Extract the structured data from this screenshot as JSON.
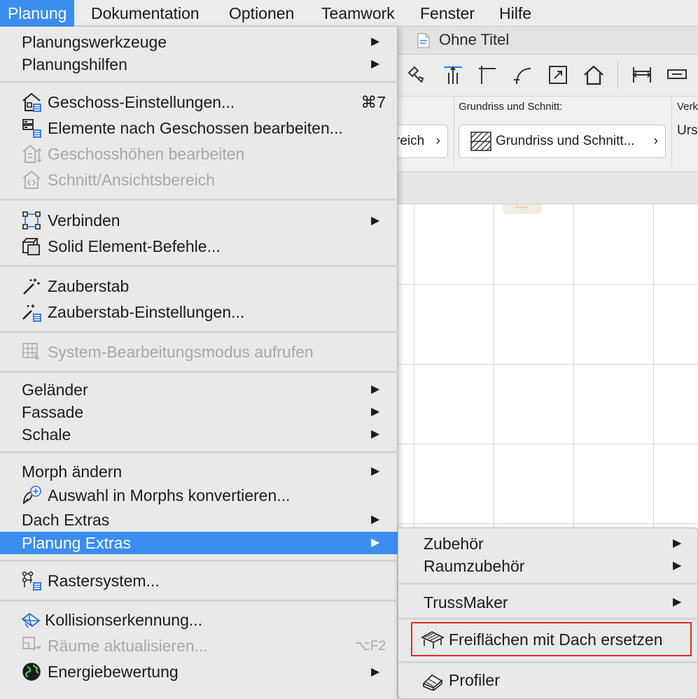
{
  "menubar": {
    "items": [
      "Planung",
      "Dokumentation",
      "Optionen",
      "Teamwork",
      "Fenster",
      "Hilfe"
    ],
    "active_index": 0
  },
  "window": {
    "title": "Ohne Titel",
    "infobox": {
      "section_label": "Grundriss und Schnitt:",
      "left_button_text": "reich",
      "button_text": "Grundriss und Schnitt...",
      "right_label_1": "Verk",
      "right_label_2": "Urs"
    },
    "marker_text": "----"
  },
  "menu": {
    "items": [
      {
        "label": "Planungswerkzeuge",
        "submenu": "▶"
      },
      {
        "label": "Planungshilfen",
        "submenu": "▶"
      },
      {
        "label": "Geschoss-Einstellungen...",
        "icon": "story-settings-icon",
        "shortcut": "⌘7"
      },
      {
        "label": "Elemente nach Geschossen bearbeiten...",
        "icon": "edit-by-story-icon"
      },
      {
        "label": "Geschosshöhen bearbeiten",
        "icon": "story-heights-icon",
        "disabled": true
      },
      {
        "label": "Schnitt/Ansichtsbereich",
        "icon": "section-view-icon",
        "disabled": true
      },
      {
        "label": "Verbinden",
        "icon": "connect-icon",
        "submenu": "▶"
      },
      {
        "label": "Solid Element-Befehle...",
        "icon": "solid-element-icon"
      },
      {
        "label": "Zauberstab",
        "icon": "magic-wand-icon"
      },
      {
        "label": "Zauberstab-Einstellungen...",
        "icon": "magic-wand-settings-icon"
      },
      {
        "label": "System-Bearbeitungsmodus aufrufen",
        "icon": "system-edit-icon",
        "disabled": true
      },
      {
        "label": "Geländer",
        "submenu": "▶"
      },
      {
        "label": "Fassade",
        "submenu": "▶"
      },
      {
        "label": "Schale",
        "submenu": "▶"
      },
      {
        "label": "Morph ändern",
        "submenu": "▶"
      },
      {
        "label": "Auswahl in Morphs konvertieren...",
        "icon": "convert-to-morph-icon"
      },
      {
        "label": "Dach Extras",
        "submenu": "▶"
      },
      {
        "label": "Planung Extras",
        "submenu": "▶",
        "active": true
      },
      {
        "label": "Rastersystem...",
        "icon": "grid-system-icon"
      },
      {
        "label": "Kollisionserkennung...",
        "icon": "collision-detection-icon"
      },
      {
        "label": "Räume aktualisieren...",
        "icon": "update-zones-icon",
        "shortcut": "⌥F2",
        "disabled": true
      },
      {
        "label": "Energiebewertung",
        "icon": "energy-globe-icon",
        "submenu": "▶"
      }
    ]
  },
  "submenu": {
    "items": [
      {
        "label": "Zubehör",
        "submenu": "▶"
      },
      {
        "label": "Raumzubehör",
        "submenu": "▶"
      },
      {
        "label": "TrussMaker",
        "submenu": "▶"
      },
      {
        "label": "Freiflächen mit Dach ersetzen",
        "icon": "replace-roof-icon",
        "highlighted": true
      },
      {
        "label": "Profiler",
        "icon": "profiler-icon"
      }
    ]
  },
  "colors": {
    "selection": "#3b8ef0",
    "highlight_box": "#e2301f",
    "green_line": "#2ec82e"
  }
}
